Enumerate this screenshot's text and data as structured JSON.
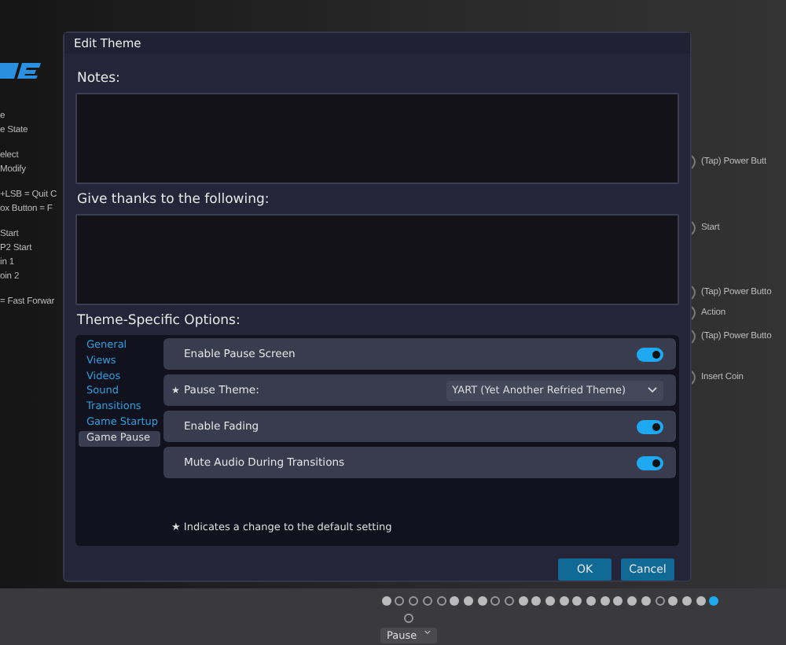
{
  "background": {
    "left_hints": [
      [
        "e",
        "e State"
      ],
      [
        "elect",
        "Modify"
      ],
      [
        "+LSB = Quit C",
        "ox Button = F"
      ],
      [
        "Start",
        "P2 Start",
        "in 1",
        "oin 2"
      ],
      [
        "= Fast Forwar"
      ]
    ],
    "right_hints": [
      {
        "label": "(Tap) Power Butt"
      },
      {
        "label": "Start"
      },
      {
        "label": "(Tap) Power Butto"
      },
      {
        "label": "Action"
      },
      {
        "label": "(Tap) Power Butto"
      },
      {
        "label": "Insert Coin"
      }
    ]
  },
  "dialog": {
    "title": "Edit Theme",
    "notes_label": "Notes:",
    "thanks_label": "Give thanks to the following:",
    "options_label": "Theme-Specific Options:",
    "categories": [
      {
        "label": "General",
        "selected": false
      },
      {
        "label": "Views",
        "selected": false
      },
      {
        "label": "Videos",
        "selected": false
      },
      {
        "label": "Sound",
        "selected": false
      },
      {
        "label": "Transitions",
        "selected": false
      },
      {
        "label": "Game Startup",
        "selected": false
      },
      {
        "label": "Game Pause",
        "selected": true
      }
    ],
    "options": [
      {
        "kind": "toggle",
        "label": "Enable Pause Screen",
        "changed": false,
        "on": true
      },
      {
        "kind": "select",
        "label": "Pause Theme:",
        "changed": true,
        "value": "YART (Yet Another Refried Theme)"
      },
      {
        "kind": "toggle",
        "label": "Enable Fading",
        "changed": false,
        "on": true
      },
      {
        "kind": "toggle",
        "label": "Mute Audio During Transitions",
        "changed": false,
        "on": true
      }
    ],
    "star": "★",
    "footnote": "Indicates a change to the default setting",
    "buttons": [
      "OK",
      "Cancel"
    ]
  },
  "pager": [
    {
      "kind": "filled"
    },
    {
      "kind": "open"
    },
    {
      "kind": "open"
    },
    {
      "kind": "open"
    },
    {
      "kind": "open"
    },
    {
      "kind": "filled"
    },
    {
      "kind": "filled"
    },
    {
      "kind": "filled"
    },
    {
      "kind": "open"
    },
    {
      "kind": "open"
    },
    {
      "kind": "filled"
    },
    {
      "kind": "filled"
    },
    {
      "kind": "filled"
    },
    {
      "kind": "filled"
    },
    {
      "kind": "filled"
    },
    {
      "kind": "filled"
    },
    {
      "kind": "filled"
    },
    {
      "kind": "filled"
    },
    {
      "kind": "filled"
    },
    {
      "kind": "filled"
    },
    {
      "kind": "open"
    },
    {
      "kind": "filled"
    },
    {
      "kind": "filled"
    },
    {
      "kind": "filled"
    },
    {
      "kind": "current"
    }
  ],
  "bottom_select": {
    "value": "Pause"
  }
}
